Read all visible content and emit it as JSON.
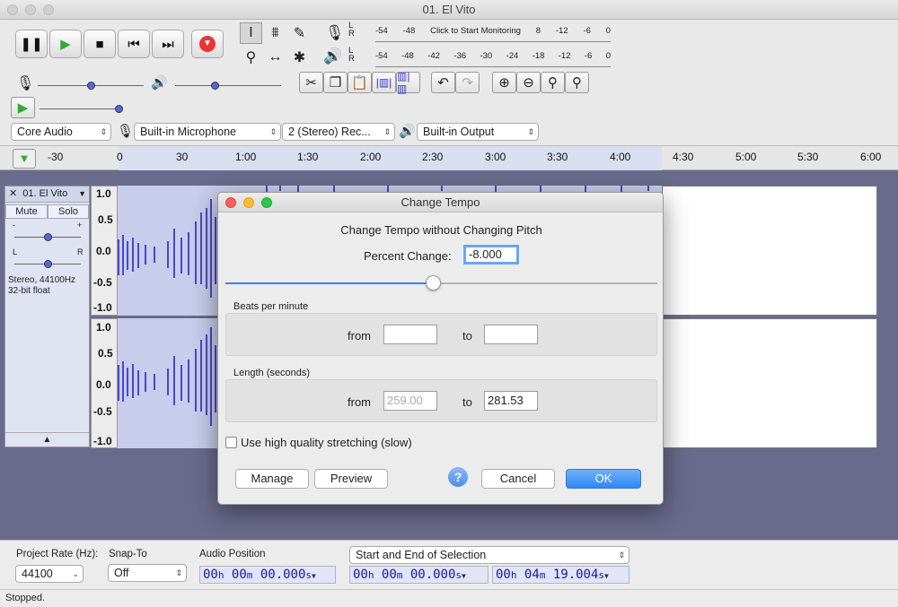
{
  "window": {
    "title": "01. El Vito"
  },
  "meters": {
    "record_scale": [
      "-54",
      "-48",
      "Click to Start Monitoring",
      "8",
      "-12",
      "-6",
      "0"
    ],
    "play_scale": [
      "-54",
      "-48",
      "-42",
      "-36",
      "-30",
      "-24",
      "-18",
      "-12",
      "-6",
      "0"
    ],
    "channel_l": "L",
    "channel_r": "R"
  },
  "devices": {
    "host": "Core Audio",
    "input": "Built-in Microphone",
    "channels": "2 (Stereo) Rec...",
    "output": "Built-in Output"
  },
  "timeline": {
    "ticks": [
      "-30",
      "0",
      "30",
      "1:00",
      "1:30",
      "2:00",
      "2:30",
      "3:00",
      "3:30",
      "4:00",
      "4:30",
      "5:00",
      "5:30",
      "6:00"
    ]
  },
  "track": {
    "name": "01. El Vito",
    "mute_label": "Mute",
    "solo_label": "Solo",
    "gain_minus": "-",
    "gain_plus": "+",
    "pan_left": "L",
    "pan_right": "R",
    "info_line1": "Stereo, 44100Hz",
    "info_line2": "32-bit float",
    "yscale_top": [
      "1.0",
      "0.5",
      "0.0",
      "-0.5",
      "-1.0"
    ],
    "yscale_bottom": [
      "1.0",
      "0.5",
      "0.0",
      "-0.5",
      "-1.0"
    ]
  },
  "dialog": {
    "title": "Change Tempo",
    "heading": "Change Tempo without Changing Pitch",
    "percent_label": "Percent Change:",
    "percent_value": "-8.000",
    "slider_percent": 48,
    "bpm_label": "Beats per minute",
    "bpm_from_label": "from",
    "bpm_to_label": "to",
    "bpm_from_value": "",
    "bpm_to_value": "",
    "length_label": "Length (seconds)",
    "length_from_label": "from",
    "length_to_label": "to",
    "length_from_value": "259.00",
    "length_to_value": "281.53",
    "hq_label": "Use high quality stretching (slow)",
    "hq_checked": false,
    "manage_label": "Manage",
    "preview_label": "Preview",
    "help_label": "?",
    "cancel_label": "Cancel",
    "ok_label": "OK"
  },
  "selection_bar": {
    "project_rate_label": "Project Rate (Hz):",
    "project_rate_value": "44100",
    "snap_label": "Snap-To",
    "snap_value": "Off",
    "audio_position_label": "Audio Position",
    "audio_position": {
      "h": "00",
      "m": "00",
      "s": "00.000"
    },
    "selection_mode": "Start and End of Selection",
    "sel_start": {
      "h": "00",
      "m": "00",
      "s": "00.000"
    },
    "sel_end": {
      "h": "00",
      "m": "04",
      "s": "19.004"
    },
    "unit_h": "h",
    "unit_m": "m",
    "unit_s": "s"
  },
  "status": {
    "text": "Stopped."
  }
}
